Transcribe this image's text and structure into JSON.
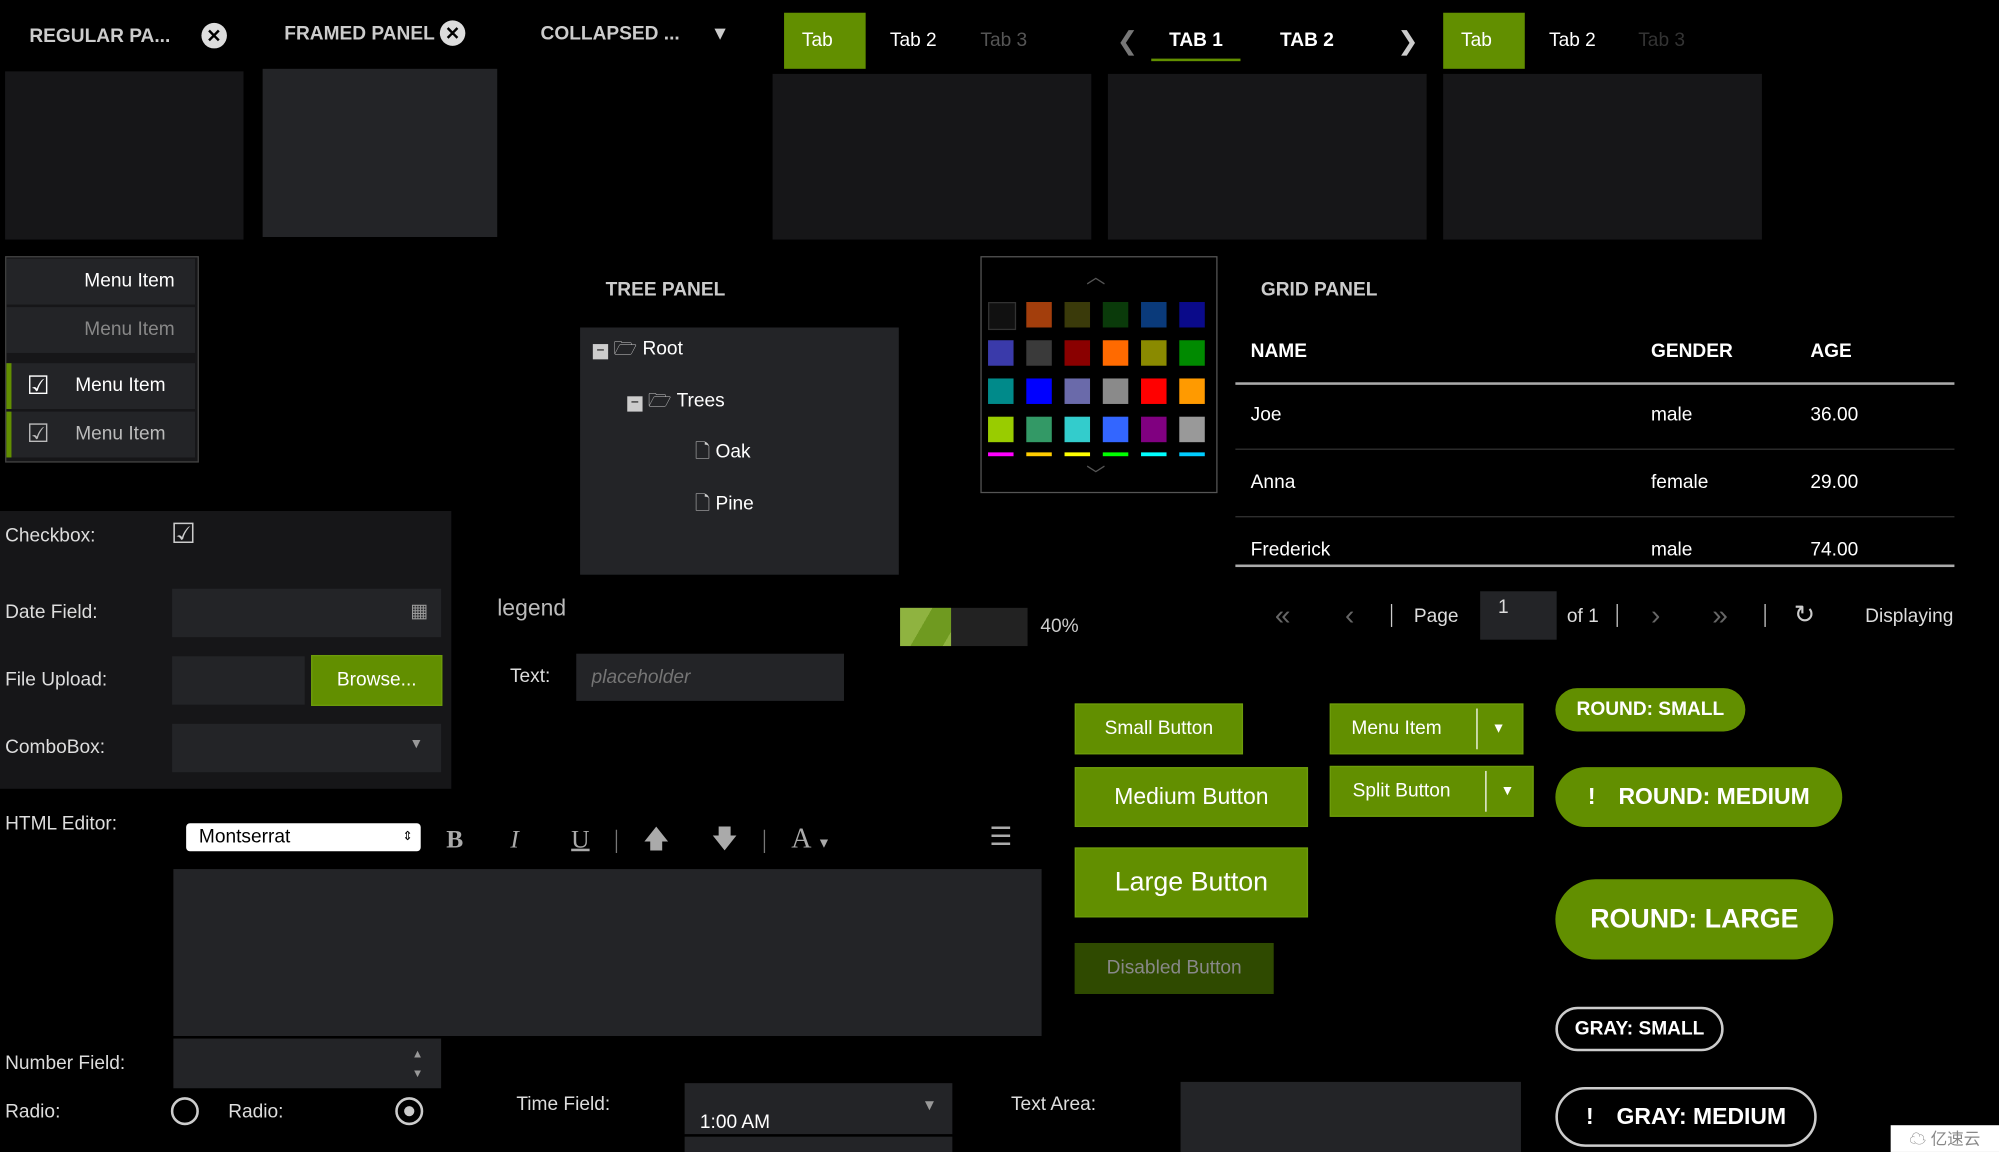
{
  "panels": {
    "regular": "REGULAR PA...",
    "framed": "FRAMED PANEL",
    "collapsed": "COLLAPSED ..."
  },
  "tabs1": [
    "Tab 1",
    "Tab 2",
    "Tab 3"
  ],
  "tabs2": [
    "TAB 1",
    "TAB 2"
  ],
  "tabs3": [
    "Tab 1",
    "Tab 2",
    "Tab 3"
  ],
  "menu": [
    "Menu Item",
    "Menu Item",
    "Menu Item",
    "Menu Item"
  ],
  "tree": {
    "title": "TREE PANEL",
    "nodes": [
      "Root",
      "Trees",
      "Oak",
      "Pine"
    ]
  },
  "palette": {
    "colors": [
      "#111111",
      "#a33e0c",
      "#3a3a0a",
      "#0a3a0a",
      "#0a3a7a",
      "#0a0a8a",
      "#3a3aaa",
      "#3a3a3a",
      "#8a0000",
      "#ff6a00",
      "#8a8a00",
      "#008a00",
      "#008a8a",
      "#0000ff",
      "#6a6aaa",
      "#8a8a8a",
      "#ff0000",
      "#ff9a00",
      "#99cc00",
      "#339966",
      "#33cccc",
      "#3366ff",
      "#800080",
      "#999999"
    ],
    "bars": [
      "#ff00ff",
      "#ffcc00",
      "#ffff00",
      "#00ff00",
      "#00ffff",
      "#00ccff"
    ]
  },
  "grid": {
    "title": "GRID PANEL",
    "columns": [
      "NAME",
      "GENDER",
      "AGE"
    ],
    "rows": [
      [
        "Joe",
        "male",
        "36.00"
      ],
      [
        "Anna",
        "female",
        "29.00"
      ],
      [
        "Frederick",
        "male",
        "74.00"
      ]
    ],
    "pager": {
      "page_label": "Page",
      "page": "1",
      "of": "of 1",
      "displaying": "Displaying"
    }
  },
  "form": {
    "checkbox": "Checkbox:",
    "date": "Date Field:",
    "file": "File Upload:",
    "browse": "Browse...",
    "combo": "ComboBox:",
    "html_editor": "HTML Editor:",
    "font": "Montserrat",
    "number": "Number Field:",
    "radio1": "Radio:",
    "radio2": "Radio:",
    "time": "Time Field:",
    "time_value": "1:00 AM",
    "textarea": "Text Area:"
  },
  "legend": "legend",
  "text_field": {
    "label": "Text:",
    "placeholder": "placeholder"
  },
  "progress": {
    "value": 40,
    "label": "40%"
  },
  "buttons": {
    "small": "Small Button",
    "medium": "Medium Button",
    "large": "Large Button",
    "disabled": "Disabled Button",
    "menu_item": "Menu Item",
    "split": "Split Button",
    "round_small": "ROUND: SMALL",
    "round_medium": "ROUND: MEDIUM",
    "round_large": "ROUND: LARGE",
    "gray_small": "GRAY: SMALL",
    "gray_medium": "GRAY: MEDIUM"
  },
  "accent": "#628f00",
  "watermark": "亿速云"
}
